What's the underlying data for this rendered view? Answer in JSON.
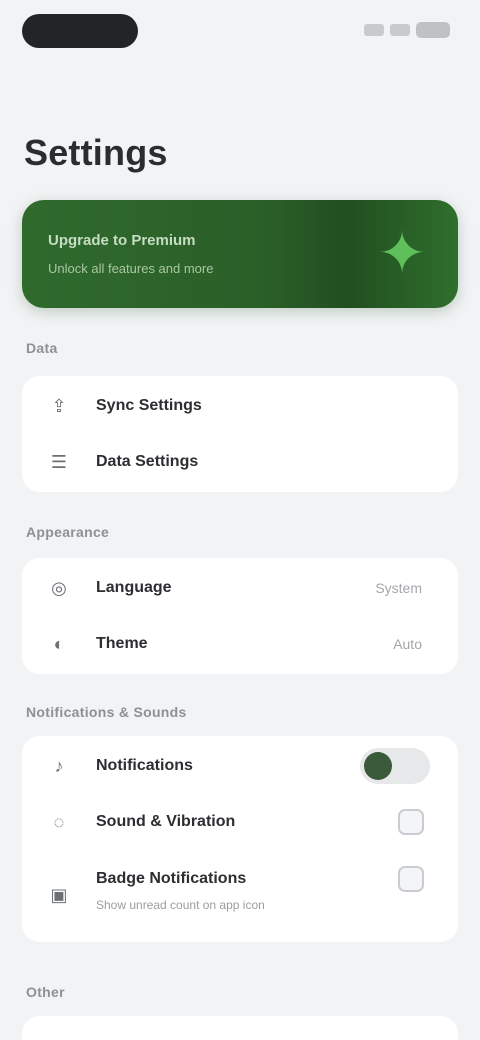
{
  "status_bar": {
    "time": ""
  },
  "page": {
    "title": "Settings"
  },
  "banner": {
    "title": "Upgrade to Premium",
    "subtitle": "Unlock all features and more",
    "icon": "sparkle-icon",
    "color": "#2f6a2c"
  },
  "sections": [
    {
      "label": "Data",
      "rows": [
        {
          "icon": "upload-icon",
          "label": "Sync Settings"
        },
        {
          "icon": "list-icon",
          "label": "Data Settings"
        }
      ]
    },
    {
      "label": "Appearance",
      "rows": [
        {
          "icon": "globe-icon",
          "label": "Language",
          "value": "System"
        },
        {
          "icon": "theme-icon",
          "label": "Theme",
          "value": "Auto"
        }
      ]
    },
    {
      "label": "Notifications & Sounds",
      "rows": [
        {
          "icon": "bell-icon",
          "label": "Notifications",
          "toggle_on": true
        },
        {
          "icon": "sound-icon",
          "label": "Sound & Vibration"
        },
        {
          "icon": "badge-icon",
          "label": "Badge Notifications",
          "sub": "Show unread count on app icon"
        }
      ]
    },
    {
      "label": "Other"
    }
  ]
}
